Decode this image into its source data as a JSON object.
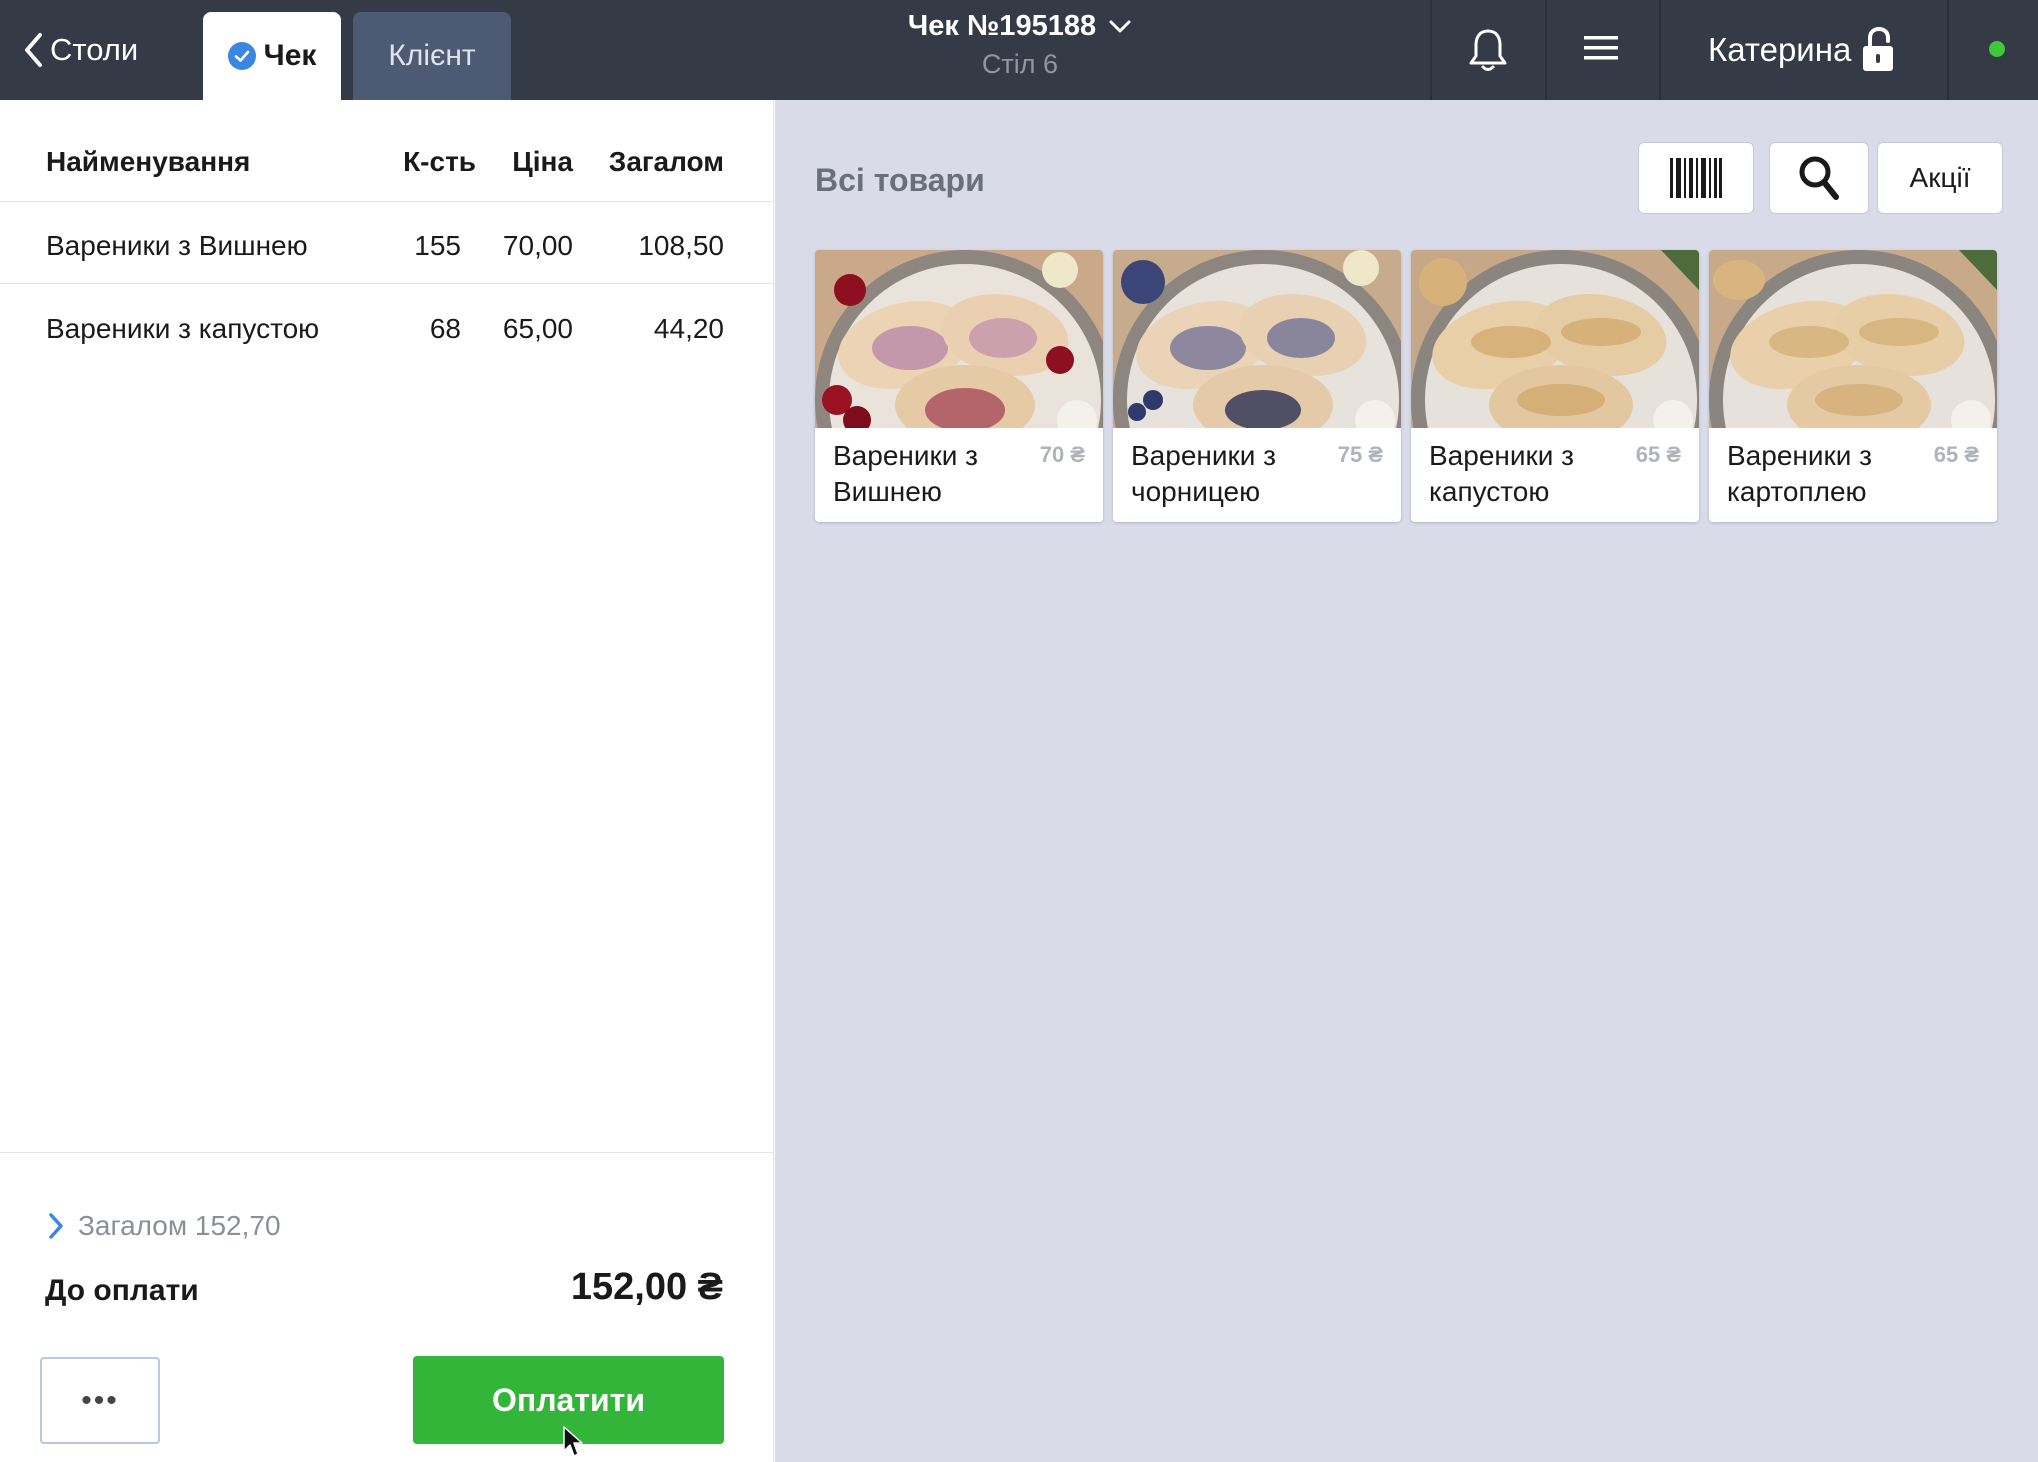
{
  "header": {
    "back_label": "Столи",
    "tab_check": "Чек",
    "tab_client": "Клієнт",
    "receipt_number": "Чек №195188",
    "table_label": "Стіл 6",
    "user_name": "Катерина",
    "icons": [
      "chevron-left-icon",
      "check-circle-icon",
      "chevron-down-icon",
      "bell-icon",
      "hamburger-menu-icon",
      "unlocked-padlock-icon",
      "online-status-dot"
    ],
    "status_color": "#3ec938"
  },
  "order": {
    "columns": {
      "name": "Найменування",
      "qty": "К-сть",
      "price": "Ціна",
      "total": "Загалом"
    },
    "rows": [
      {
        "name": "Вареники з Вишнею",
        "qty": "155",
        "price": "70,00",
        "total": "108,50"
      },
      {
        "name": "Вареники з капустою",
        "qty": "68",
        "price": "65,00",
        "total": "44,20"
      }
    ],
    "subtotal": "Загалом 152,70",
    "due_label": "До оплати",
    "due_amount": "152,00 ₴",
    "more_label": "•••",
    "pay_label": "Оплатити",
    "pay_color": "#33b53a"
  },
  "catalog": {
    "title": "Всі товари",
    "promo_label": "Акції",
    "tool_icons": [
      "barcode-icon",
      "search-icon"
    ],
    "products": [
      {
        "name": "Вареники з Вишнею",
        "price": "70 ₴",
        "image": "dumplings-cherry-photo"
      },
      {
        "name": "Вареники з чорницею",
        "price": "75 ₴",
        "image": "dumplings-blueberry-photo"
      },
      {
        "name": "Вареники з капустою",
        "price": "65 ₴",
        "image": "dumplings-cabbage-photo"
      },
      {
        "name": "Вареники з картоплею",
        "price": "65 ₴",
        "image": "dumplings-potato-photo"
      }
    ]
  }
}
